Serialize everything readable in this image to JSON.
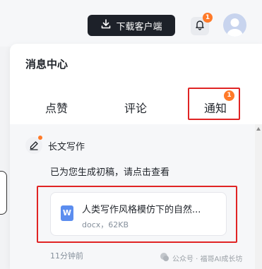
{
  "topbar": {
    "download_label": "下载客户端",
    "bell_badge": "1"
  },
  "panel": {
    "title": "消息中心",
    "tabs": [
      {
        "label": "点赞"
      },
      {
        "label": "评论"
      },
      {
        "label": "通知",
        "badge": "1"
      }
    ]
  },
  "notification": {
    "source": "长文写作",
    "message": "已为您生成初稿，请点击查看",
    "file": {
      "type_letter": "W",
      "name": "人类写作风格模仿下的自然...",
      "meta": "docx，62KB"
    },
    "time": "11分钟前"
  },
  "watermark": {
    "text": "公众号 · 福哥AI成长坊"
  },
  "colors": {
    "accent": "#ff7a29",
    "highlight": "#e02424",
    "word_blue": "#5b8def"
  }
}
